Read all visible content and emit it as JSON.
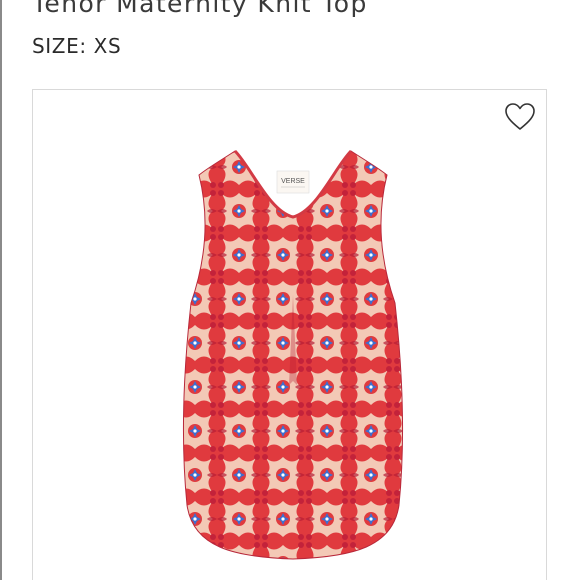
{
  "product": {
    "title": "Tenor Maternity Knit Top",
    "size_label": "SIZE:",
    "size_value": "XS",
    "brand_tag": "VERSE"
  },
  "icons": {
    "favorite": "heart-outline-icon"
  },
  "colors": {
    "print_red": "#e03a3e",
    "print_cream": "#f6d9c4",
    "print_blue": "#3b6fd1",
    "border": "#d9d9d9"
  }
}
